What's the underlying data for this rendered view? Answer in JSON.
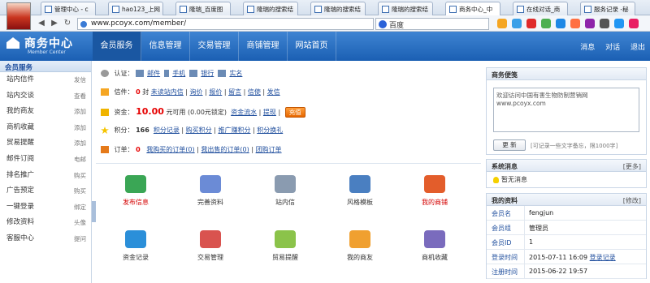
{
  "browser": {
    "tabs": [
      {
        "title": "管理中心 - c"
      },
      {
        "title": "hao123_上网"
      },
      {
        "title": "隆瑞_百度图"
      },
      {
        "title": "隆瑞的搜索结"
      },
      {
        "title": "隆瑞的搜索结"
      },
      {
        "title": "隆瑞的搜索结"
      },
      {
        "title": "商务中心_中"
      },
      {
        "title": "在线对话_商"
      },
      {
        "title": "服务记录 -秘"
      }
    ],
    "url": "www.pcoyx.com/member/",
    "search_placeholder": "百度"
  },
  "header": {
    "logo_title": "商务中心",
    "logo_subtitle": "Member Center",
    "nav": [
      "会员服务",
      "信息管理",
      "交易管理",
      "商铺管理",
      "网站首页"
    ],
    "right": [
      "消息",
      "对话",
      "退出"
    ]
  },
  "sidebar": {
    "heading": "会员服务",
    "items": [
      {
        "label": "站内信件",
        "action": "发信"
      },
      {
        "label": "站内交谈",
        "action": "查看"
      },
      {
        "label": "我的商友",
        "action": "添加"
      },
      {
        "label": "商机收藏",
        "action": "添加"
      },
      {
        "label": "贸易提醒",
        "action": "添加"
      },
      {
        "label": "邮件订阅",
        "action": "电邮"
      },
      {
        "label": "排名推广",
        "action": "购买"
      },
      {
        "label": "广告预定",
        "action": "购买"
      },
      {
        "label": "一键登录",
        "action": "绑定"
      },
      {
        "label": "修改资料",
        "action": "头像"
      },
      {
        "label": "客服中心",
        "action": "提问"
      }
    ]
  },
  "info": {
    "auth_label": "认证：",
    "auth_links": [
      "邮件",
      "手机",
      "银行",
      "实名"
    ],
    "mail_label": "信件：",
    "mail_count": "0",
    "mail_unit": "封",
    "mail_links": [
      "未读站内信",
      "询价",
      "报价",
      "留言",
      "信使",
      "发信"
    ],
    "funds_label": "资金：",
    "funds_amount": "10.00",
    "funds_text": "元可用 (0.00元锁定)",
    "funds_links": [
      "资金流水",
      "提现"
    ],
    "recharge_label": "充值",
    "points_label": "积分：",
    "points_value": "166",
    "points_links": [
      "积分记录",
      "购买积分",
      "推广赚积分",
      "积分换礼"
    ],
    "orders_label": "订单：",
    "orders_count": "0",
    "orders_links": [
      "我购买的订单(0)",
      "我出售的订单(0)",
      "团购订单"
    ]
  },
  "grid": [
    {
      "label": "发布信息",
      "icon": "publish-icon",
      "red": true
    },
    {
      "label": "完善资料",
      "icon": "profile-edit-icon",
      "red": false
    },
    {
      "label": "站内信",
      "icon": "inbox-icon",
      "red": false
    },
    {
      "label": "风格模板",
      "icon": "template-icon",
      "red": false
    },
    {
      "label": "我的商铺",
      "icon": "shop-icon",
      "red": true
    },
    {
      "label": "资金记录",
      "icon": "funds-record-icon",
      "red": false
    },
    {
      "label": "交易管理",
      "icon": "trade-icon",
      "red": false
    },
    {
      "label": "贸易提醒",
      "icon": "reminder-icon",
      "red": false
    },
    {
      "label": "我的商友",
      "icon": "friends-icon",
      "red": false
    },
    {
      "label": "商机收藏",
      "icon": "favorites-icon",
      "red": false
    }
  ],
  "memo": {
    "title": "商务便笺",
    "text": "欢迎访问中国有害生物防制营销网 www.pcoyx.com",
    "button": "更 新",
    "hint": "[可记录一些文字备忘，限1000字]"
  },
  "system": {
    "title": "系统消息",
    "more": "[更多]",
    "text": "暂无消息"
  },
  "profile": {
    "title": "我的资料",
    "edit": "[修改]",
    "rows": [
      {
        "k": "会员名",
        "v": "fengjun"
      },
      {
        "k": "会员组",
        "v": "管理员"
      },
      {
        "k": "会员ID",
        "v": "1"
      },
      {
        "k": "登录时间",
        "v": "2015-07-11 16:09",
        "link": "登录记录"
      },
      {
        "k": "注册时间",
        "v": "2015-06-22 19:57"
      }
    ]
  },
  "colors": {
    "header": "#2a6fc4",
    "accent_red": "#e60000",
    "recharge": "#f57c00"
  }
}
